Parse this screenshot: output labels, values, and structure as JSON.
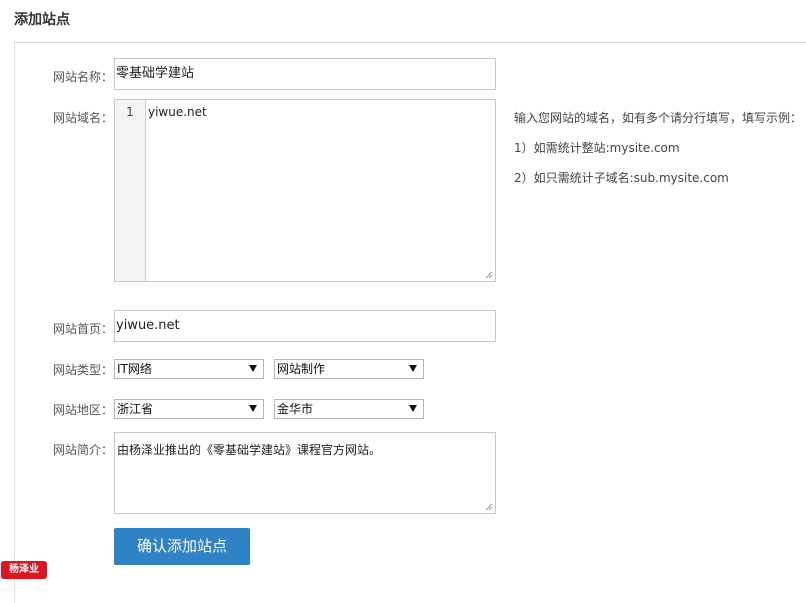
{
  "header": {
    "title": "添加站点"
  },
  "form": {
    "site_name": {
      "label": "网站名称：",
      "value": "零基础学建站"
    },
    "site_domain": {
      "label": "网站域名：",
      "line_number": "1",
      "value": "yiwue.net",
      "hints": [
        "输入您网站的域名，如有多个请分行填写，填写示例：",
        "1）如需统计整站:mysite.com",
        "2）如只需统计子域名:sub.mysite.com"
      ]
    },
    "site_home": {
      "label": "网站首页：",
      "value": "yiwue.net"
    },
    "site_type": {
      "label": "网站类型：",
      "select1": "IT网络",
      "select2": "网站制作"
    },
    "site_region": {
      "label": "网站地区：",
      "select1": "浙江省",
      "select2": "金华市"
    },
    "site_intro": {
      "label": "网站简介：",
      "value": "由杨泽业推出的《零基础学建站》课程官方网站。"
    },
    "submit_label": "确认添加站点"
  },
  "watermark": {
    "text": "杨泽业"
  },
  "colors": {
    "button": "#2f82c4",
    "watermark": "#e0141e",
    "border": "#c8c8c8"
  }
}
